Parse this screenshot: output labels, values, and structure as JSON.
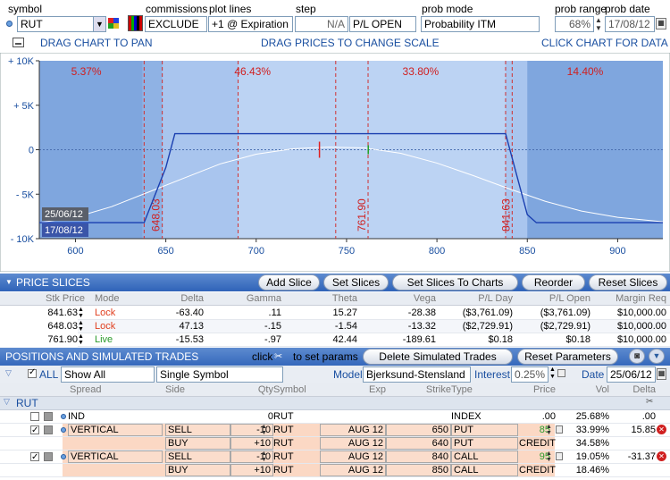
{
  "top": {
    "symbol_label": "symbol",
    "symbol_value": "RUT",
    "commissions_label": "commissions",
    "commissions_value": "EXCLUDE",
    "plotlines_label": "plot lines",
    "plotlines_value": "+1 @ Expiration",
    "step_label": "step",
    "step_value": "N/A",
    "pl_value": "P/L OPEN",
    "probmode_label": "prob mode",
    "probmode_value": "Probability ITM",
    "probrange_label": "prob range",
    "probrange_value": "68%",
    "probdate_label": "prob date",
    "probdate_value": "17/08/12"
  },
  "chartbar": {
    "drag_pan": "DRAG CHART TO PAN",
    "drag_prices": "DRAG PRICES TO CHANGE SCALE",
    "click_chart": "CLICK CHART FOR DATA"
  },
  "chart_data": {
    "type": "line",
    "y_ticks": [
      "+ 10K",
      "+ 5K",
      "0",
      "- 5K",
      "- 10K"
    ],
    "y_values": [
      10000,
      5000,
      0,
      -5000,
      -10000
    ],
    "x_ticks": [
      "600",
      "650",
      "700",
      "750",
      "800",
      "850",
      "900"
    ],
    "x_values": [
      600,
      650,
      700,
      750,
      800,
      850,
      900
    ],
    "xlim": [
      580,
      925
    ],
    "ylim": [
      -10000,
      10000
    ],
    "prob_labels": [
      "5.37%",
      "46.43%",
      "33.80%",
      "14.40%"
    ],
    "price_lines": [
      "648.03",
      "761.90",
      "841.63"
    ],
    "date_labels": [
      "25/06/12",
      "17/08/12"
    ],
    "series": [
      {
        "name": "17/08/12",
        "color": "#1a3fb0",
        "x": [
          580,
          638,
          650,
          655,
          838,
          850,
          855,
          925
        ],
        "y": [
          -8200,
          -8200,
          -2000,
          1800,
          1800,
          -7300,
          -8200,
          -8200
        ]
      },
      {
        "name": "25/06/12",
        "color": "#ffffff",
        "x": [
          580,
          600,
          620,
          640,
          660,
          680,
          700,
          720,
          740,
          760,
          780,
          800,
          820,
          840,
          860,
          880,
          900,
          925
        ],
        "y": [
          -8200,
          -7600,
          -6400,
          -4800,
          -3200,
          -1600,
          -500,
          100,
          300,
          200,
          -400,
          -1500,
          -2900,
          -4400,
          -5800,
          -6900,
          -7600,
          -8100
        ]
      }
    ]
  },
  "slices": {
    "title": "PRICE SLICES",
    "buttons": [
      "Add Slice",
      "Set Slices",
      "Set Slices To Charts",
      "Reorder",
      "Reset Slices"
    ],
    "headers": [
      "Stk Price",
      "Mode",
      "Delta",
      "Gamma",
      "Theta",
      "Vega",
      "P/L Day",
      "P/L Open",
      "Margin Req"
    ],
    "rows": [
      [
        "841.63",
        "Lock",
        "-63.40",
        ".11",
        "15.27",
        "-28.38",
        "($3,761.09)",
        "($3,761.09)",
        "$10,000.00"
      ],
      [
        "648.03",
        "Lock",
        "47.13",
        "-.15",
        "-1.54",
        "-13.32",
        "($2,729.91)",
        "($2,729.91)",
        "$10,000.00"
      ],
      [
        "761.90",
        "Live",
        "-15.53",
        "-.97",
        "42.44",
        "-189.61",
        "$0.18",
        "$0.18",
        "$10,000.00"
      ]
    ]
  },
  "positions": {
    "title": "POSITIONS AND SIMULATED TRADES",
    "click_text": "click",
    "to_set": "to set params",
    "delete_btn": "Delete Simulated Trades",
    "reset_btn": "Reset Parameters"
  },
  "filters": {
    "all_label": "ALL",
    "show_value": "Show All",
    "symbol_mode": "Single Symbol",
    "model_label": "Model",
    "model_value": "Bjerksund-Stensland",
    "interest_label": "Interest",
    "interest_value": "0.25%",
    "date_label": "Date",
    "date_value": "25/06/12"
  },
  "pos_headers": [
    "Spread",
    "Side",
    "Qty",
    "Symbol",
    "Exp",
    "Strike",
    "Type",
    "Price",
    "Vol",
    "Delta"
  ],
  "group": "RUT",
  "pos_rows": [
    {
      "spread": "IND",
      "side": "",
      "qty": "0",
      "symbol": "RUT",
      "exp": "",
      "strike": "",
      "type": "INDEX",
      "price": ".00",
      "vol": "25.68%",
      "delta": ".00"
    },
    {
      "spread": "VERTICAL",
      "side": "SELL",
      "qty": "-10",
      "symbol": "RUT",
      "exp": "AUG 12",
      "strike": "650",
      "type": "PUT",
      "price": "85",
      "vol": "33.99%",
      "delta": "15.85"
    },
    {
      "spread": "",
      "side": "BUY",
      "qty": "+10",
      "symbol": "RUT",
      "exp": "AUG 12",
      "strike": "640",
      "type": "PUT",
      "price": "CREDIT",
      "vol": "34.58%",
      "delta": ""
    },
    {
      "spread": "VERTICAL",
      "side": "SELL",
      "qty": "-10",
      "symbol": "RUT",
      "exp": "AUG 12",
      "strike": "840",
      "type": "CALL",
      "price": "95",
      "vol": "19.05%",
      "delta": "-31.37"
    },
    {
      "spread": "",
      "side": "BUY",
      "qty": "+10",
      "symbol": "RUT",
      "exp": "AUG 12",
      "strike": "850",
      "type": "CALL",
      "price": "CREDIT",
      "vol": "18.46%",
      "delta": ""
    }
  ]
}
